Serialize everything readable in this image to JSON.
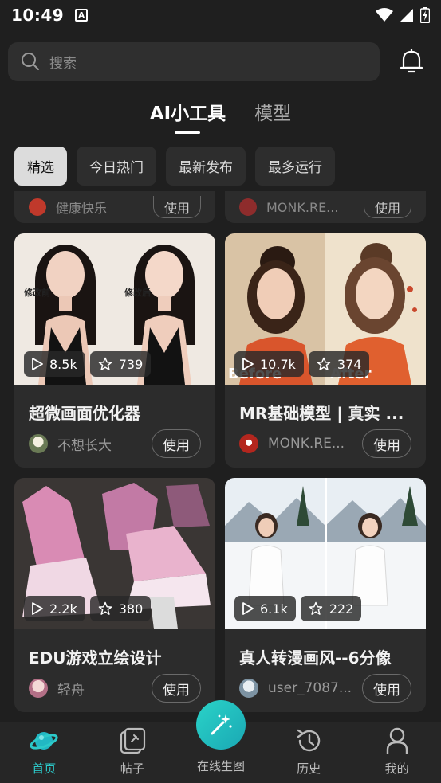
{
  "status": {
    "time": "10:49",
    "notification_letter": "A"
  },
  "search": {
    "placeholder": "搜索"
  },
  "top_tabs": [
    {
      "label": "AI小工具",
      "active": true
    },
    {
      "label": "模型",
      "active": false
    }
  ],
  "filters": [
    {
      "label": "精选",
      "active": true
    },
    {
      "label": "今日热门",
      "active": false
    },
    {
      "label": "最新发布",
      "active": false
    },
    {
      "label": "最多运行",
      "active": false
    }
  ],
  "partial_cards": [
    {
      "author": "健康快乐",
      "button": "使用"
    },
    {
      "author": "MONK.RE...",
      "button": "使用"
    }
  ],
  "cards": [
    {
      "title": "超微画面优化器",
      "author": "不想长大",
      "runs": "8.5k",
      "stars": "739",
      "button": "使用",
      "image_labels": [
        "修改前",
        "修改后"
      ]
    },
    {
      "title": "MR基础模型 | 真实 ...",
      "author": "MONK.RE...",
      "runs": "10.7k",
      "stars": "374",
      "button": "使用",
      "image_labels": [
        "Before",
        "After"
      ]
    },
    {
      "title": "EDU游戏立绘设计",
      "author": "轻舟",
      "runs": "2.2k",
      "stars": "380",
      "button": "使用"
    },
    {
      "title": "真人转漫画风--6分像",
      "author": "user_7087...",
      "runs": "6.1k",
      "stars": "222",
      "button": "使用"
    }
  ],
  "bottom_nav": [
    {
      "label": "首页",
      "icon": "home-planet-icon",
      "active": true
    },
    {
      "label": "帖子",
      "icon": "posts-icon",
      "active": false
    },
    {
      "label": "在线生图",
      "icon": "magic-wand-icon",
      "active": false
    },
    {
      "label": "历史",
      "icon": "history-icon",
      "active": false
    },
    {
      "label": "我的",
      "icon": "profile-icon",
      "active": false
    }
  ],
  "colors": {
    "background": "#1f1f1f",
    "card": "#2c2c2c",
    "accent": "#2cc9c9"
  }
}
